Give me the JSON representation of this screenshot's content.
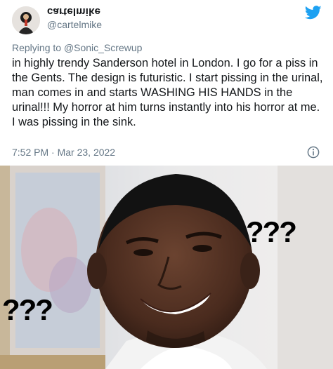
{
  "tweet": {
    "display_name": "cartelmike",
    "handle": "@cartelmike",
    "replying_prefix": "Replying to ",
    "replying_to": "@Sonic_Screwup",
    "body": "in highly trendy Sanderson hotel in London. I go for a piss in the Gents. The design is futuristic. I start pissing in the urinal, man comes in and starts WASHING HIS HANDS in the urinal!!! My horror at him turns instantly into his horror at me. I was pissing in the sink.",
    "time": "7:52 PM",
    "separator": " · ",
    "date": "Mar 23, 2022",
    "icons": [
      "twitter-bird-icon",
      "info-icon"
    ],
    "accent": "#1da1f2"
  },
  "meme": {
    "left_caption": "???",
    "right_caption": "???"
  }
}
